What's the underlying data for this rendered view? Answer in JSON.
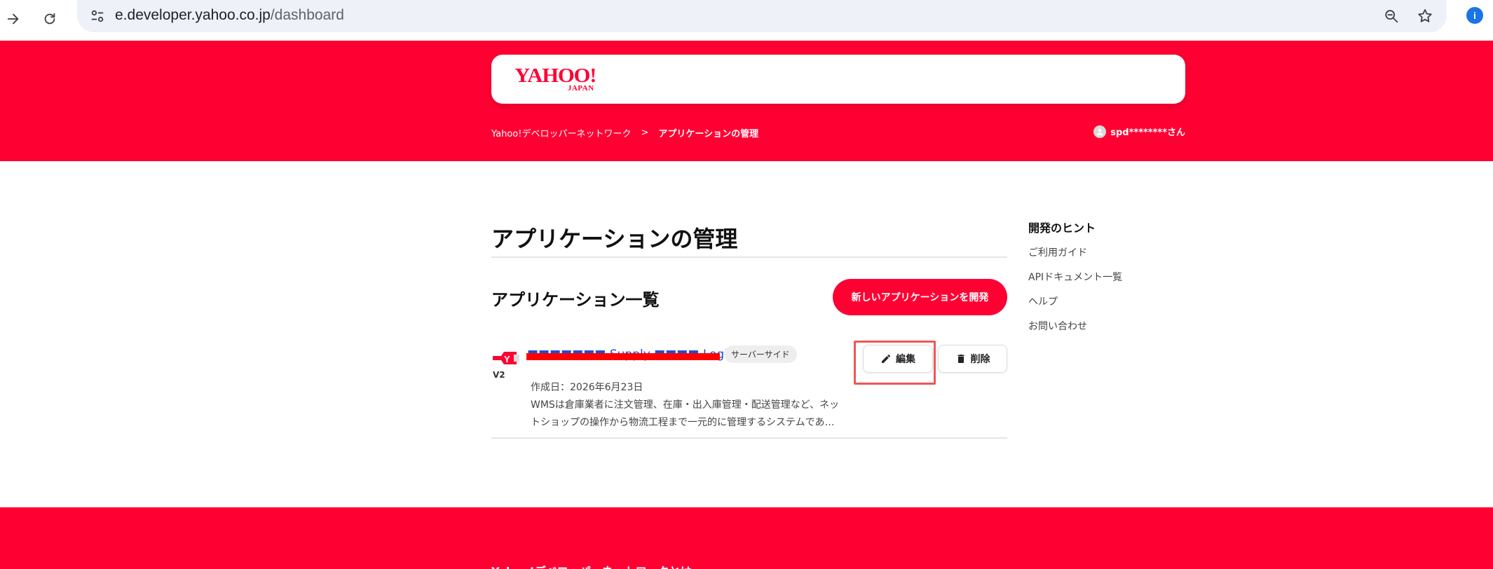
{
  "browser": {
    "url_host": "e.developer.yahoo.co.jp",
    "url_path": "/dashboard",
    "extension_badge": "i"
  },
  "header": {
    "logo_main": "YAHOO!",
    "logo_sub": "JAPAN",
    "breadcrumb": {
      "home": "Yahoo!デベロッパーネットワーク",
      "separator": ">",
      "current": "アプリケーションの管理"
    },
    "user_name": "spd********さん"
  },
  "main": {
    "page_title": "アプリケーションの管理",
    "section_title": "アプリケーション一覧",
    "new_app_button": "新しいアプリケーションを開発",
    "apps": [
      {
        "version": "V2",
        "name": "■■■■■■■ Supply ■■■■ Logistics",
        "type_badge": "サーバーサイド",
        "created": "作成日：2026年6月23日",
        "description_line1": "WMSは倉庫業者に注文管理、在庫・出入庫管理・配送管理など、ネッ",
        "description_line2": "トショップの操作から物流工程まで一元的に管理するシステムであ…",
        "edit_label": "編集",
        "delete_label": "削除"
      }
    ]
  },
  "sidebar": {
    "title": "開発のヒント",
    "links": [
      "ご利用ガイド",
      "APIドキュメント一覧",
      "ヘルプ",
      "お問い合わせ"
    ]
  },
  "footer": {
    "title": "Yahoo!デベロッパーネットワークとは"
  },
  "colors": {
    "brand_red": "#ff0033",
    "highlight": "#f05656",
    "link_blue": "#1a4ed8"
  }
}
